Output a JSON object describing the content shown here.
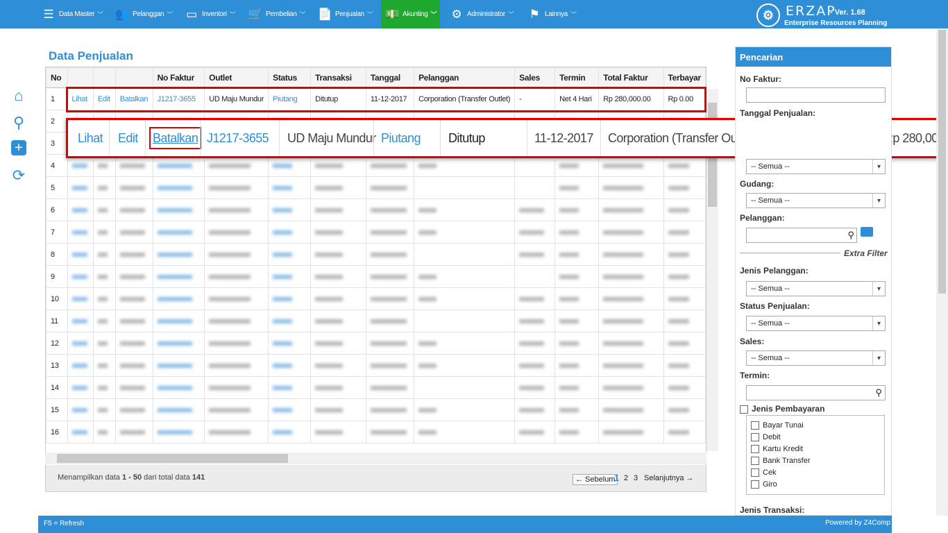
{
  "nav": {
    "items": [
      {
        "label": "Data Master",
        "icon": "list-icon"
      },
      {
        "label": "Pelanggan",
        "icon": "users-icon"
      },
      {
        "label": "Inventori",
        "icon": "box-icon"
      },
      {
        "label": "Pembelian",
        "icon": "cart-icon"
      },
      {
        "label": "Penjualan",
        "icon": "document-icon"
      },
      {
        "label": "Akunting",
        "icon": "money-icon"
      },
      {
        "label": "Administrator",
        "icon": "gear-icon"
      },
      {
        "label": "Lainnya",
        "icon": "flag-icon"
      }
    ],
    "active": "Akunting",
    "brand": "ERZAP",
    "version": "- Ver. 1.68",
    "subtitle": "Enterprise Resources Planning"
  },
  "page_title": "Data Penjualan",
  "table": {
    "columns": [
      "No",
      "",
      "",
      "",
      "No Faktur",
      "Outlet",
      "Status",
      "Transaksi",
      "Tanggal",
      "Pelanggan",
      "Sales",
      "Termin",
      "Total Faktur",
      "Terbayar"
    ],
    "row1": {
      "no": "1",
      "view": "Lihat",
      "edit": "Edit",
      "cancel": "Batalkan",
      "faktur": "J1217-3655",
      "outlet": "UD Maju Mundur",
      "status": "Piutang",
      "transaksi": "Ditutup",
      "tanggal": "11-12-2017",
      "pelanggan": "Corporation (Transfer Outlet)",
      "sales": "-",
      "termin": "Net 4 Hari",
      "total": "Rp 280,000.00",
      "terbayar": "Rp 0.00"
    },
    "zoom_total": "Rp 280,000.0",
    "row_numbers": [
      "2",
      "3",
      "4",
      "5",
      "6",
      "7",
      "8",
      "9",
      "10",
      "11",
      "12",
      "13",
      "14",
      "15",
      "16"
    ]
  },
  "footer": {
    "showing_prefix": "Menampilkan data",
    "showing_range": "1 - 50",
    "showing_mid": "dari total data",
    "total": "141",
    "prev": "← Sebelum",
    "pages": [
      "1",
      "2",
      "3"
    ],
    "next": "Selanjutnya →"
  },
  "panel": {
    "title": "Pencarian",
    "no_faktur": "No Faktur:",
    "tanggal": "Tanggal Penjualan:",
    "gudang": "Gudang:",
    "pelanggan": "Pelanggan:",
    "extra_filter": "Extra Filter",
    "jenis_pelanggan": "Jenis Pelanggan:",
    "status_penjualan": "Status Penjualan:",
    "sales": "Sales:",
    "termin": "Termin:",
    "jenis_pembayaran": "Jenis Pembayaran",
    "payment_options": [
      "Bayar Tunai",
      "Debit",
      "Kartu Kredit",
      "Bank Transfer",
      "Cek",
      "Giro"
    ],
    "jenis_transaksi": "Jenis Transaksi:",
    "semua": "-- Semua --"
  },
  "status": {
    "left": "F5 = Refresh",
    "right": "Powered by Z4Comp"
  }
}
